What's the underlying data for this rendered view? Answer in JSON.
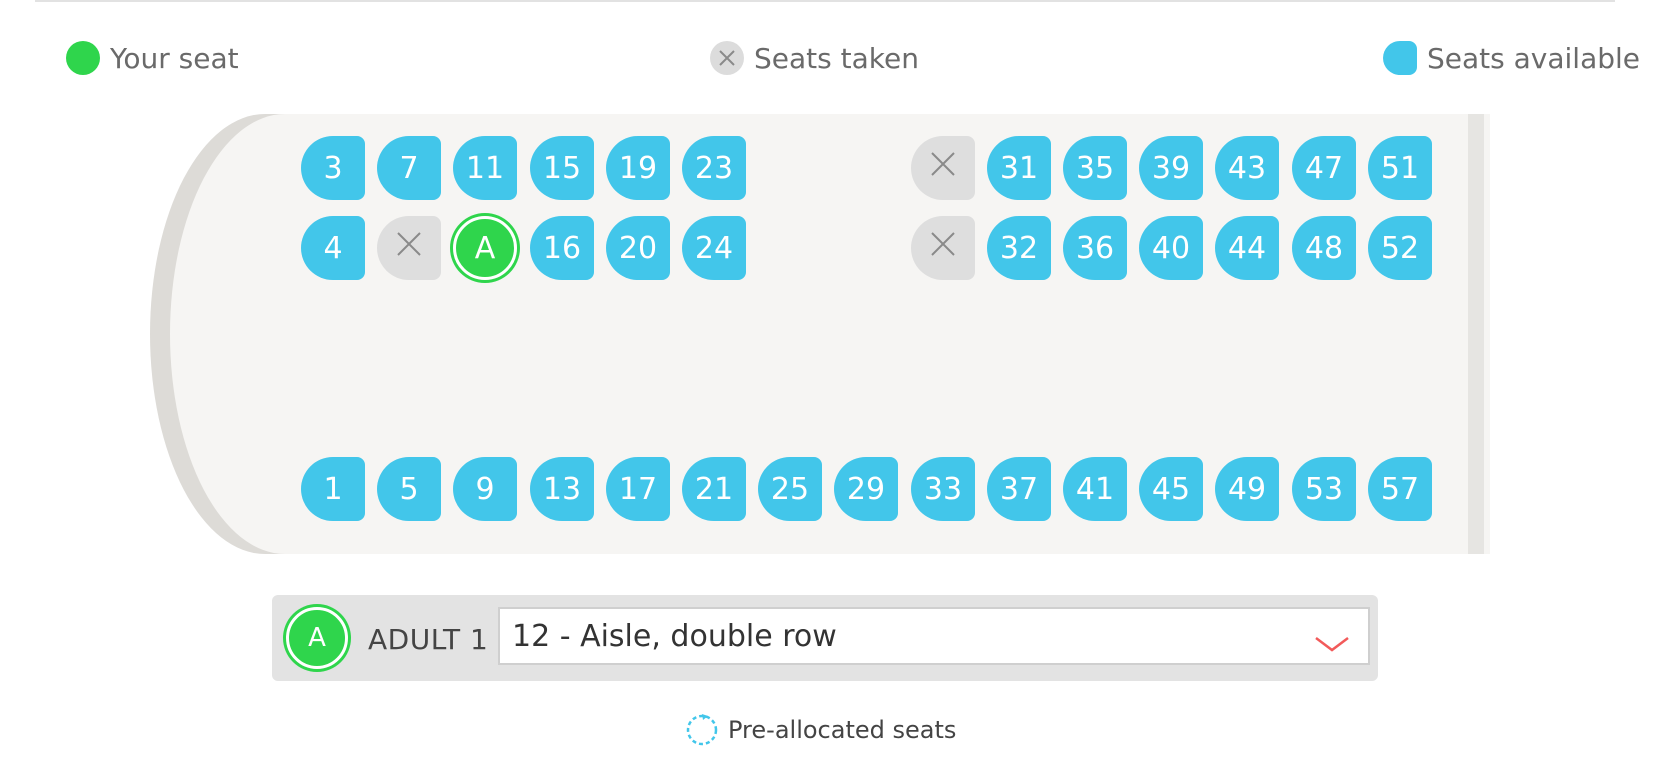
{
  "colors": {
    "available": "#42c6ea",
    "taken": "#dedede",
    "selected": "#2fd54c",
    "accent_red": "#f25a5a"
  },
  "legend": {
    "your_seat": "Your seat",
    "seats_taken": "Seats taken",
    "seats_available": "Seats available"
  },
  "seat_map": {
    "rows": [
      [
        "3",
        "7",
        "11",
        "15",
        "19",
        "23",
        null,
        null,
        "taken",
        "31",
        "35",
        "39",
        "43",
        "47",
        "51"
      ],
      [
        "4",
        "taken",
        "A",
        "16",
        "20",
        "24",
        null,
        null,
        "taken",
        "32",
        "36",
        "40",
        "44",
        "48",
        "52"
      ],
      [
        "1",
        "5",
        "9",
        "13",
        "17",
        "21",
        "25",
        "29",
        "33",
        "37",
        "41",
        "45",
        "49",
        "53",
        "57"
      ]
    ]
  },
  "passenger": {
    "badge": "A",
    "label": "ADULT 1",
    "selected_seat": "12 - Aisle, double row"
  },
  "footer": {
    "pre_allocated": "Pre-allocated seats"
  },
  "icons": [
    "close-icon",
    "chevron-down-icon",
    "refresh-icon"
  ]
}
